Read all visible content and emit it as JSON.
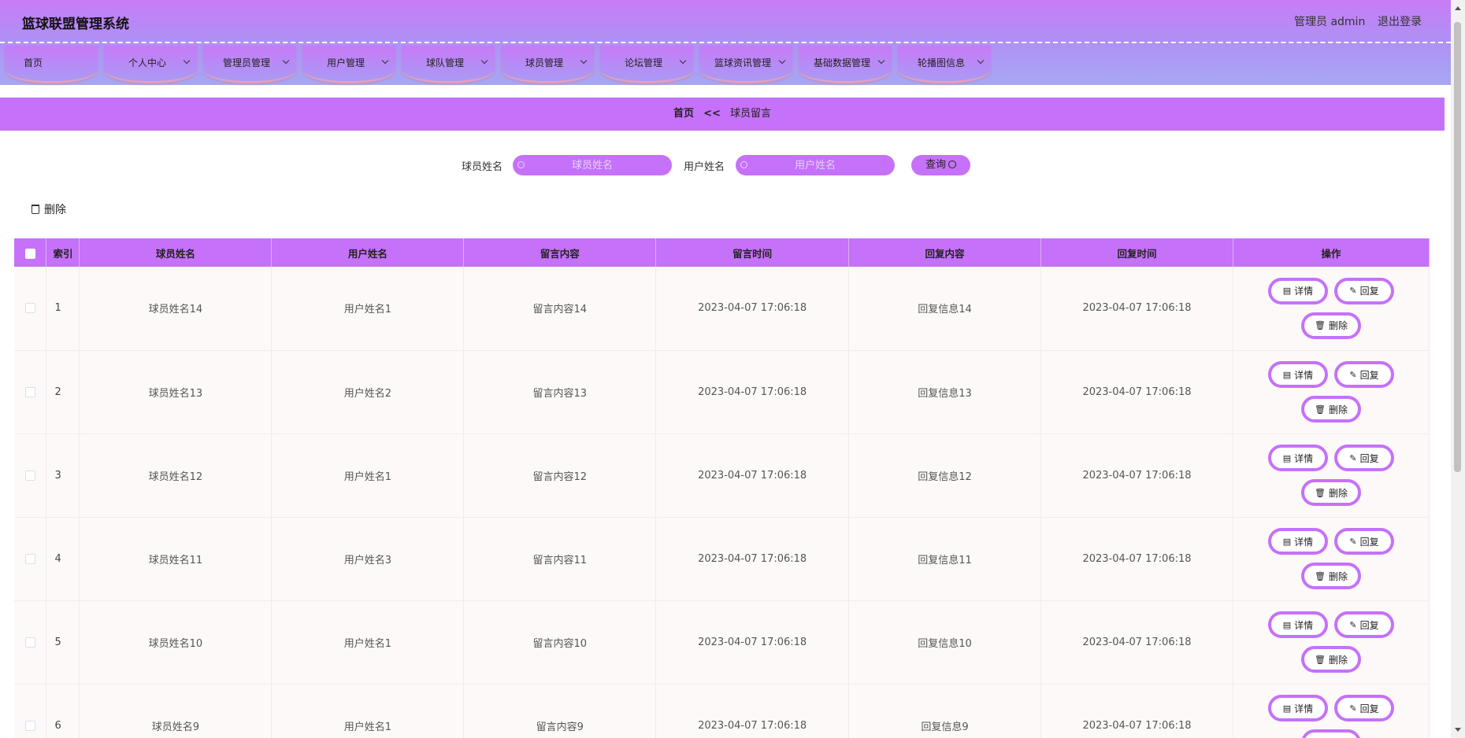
{
  "header": {
    "title": "篮球联盟管理系统",
    "user_label": "管理员 admin",
    "logout_label": "退出登录"
  },
  "nav": [
    {
      "label": "首页",
      "has_dropdown": false
    },
    {
      "label": "个人中心",
      "has_dropdown": true
    },
    {
      "label": "管理员管理",
      "has_dropdown": true
    },
    {
      "label": "用户管理",
      "has_dropdown": true
    },
    {
      "label": "球队管理",
      "has_dropdown": true
    },
    {
      "label": "球员管理",
      "has_dropdown": true
    },
    {
      "label": "论坛管理",
      "has_dropdown": true
    },
    {
      "label": "篮球资讯管理",
      "has_dropdown": true
    },
    {
      "label": "基础数据管理",
      "has_dropdown": true
    },
    {
      "label": "轮播图信息",
      "has_dropdown": true
    }
  ],
  "breadcrumb": {
    "home": "首页",
    "separator": "<<",
    "current": "球员留言"
  },
  "search": {
    "player_label": "球员姓名",
    "player_placeholder": "球员姓名",
    "user_label": "用户姓名",
    "user_placeholder": "用户姓名",
    "query_label": "查询"
  },
  "toolbar": {
    "delete_label": "删除"
  },
  "table": {
    "columns": [
      "索引",
      "球员姓名",
      "用户姓名",
      "留言内容",
      "留言时间",
      "回复内容",
      "回复时间",
      "操作"
    ],
    "rows": [
      {
        "index": "1",
        "player": "球员姓名14",
        "user": "用户姓名1",
        "content": "留言内容14",
        "time": "2023-04-07 17:06:18",
        "reply": "回复信息14",
        "reply_time": "2023-04-07 17:06:18"
      },
      {
        "index": "2",
        "player": "球员姓名13",
        "user": "用户姓名2",
        "content": "留言内容13",
        "time": "2023-04-07 17:06:18",
        "reply": "回复信息13",
        "reply_time": "2023-04-07 17:06:18"
      },
      {
        "index": "3",
        "player": "球员姓名12",
        "user": "用户姓名1",
        "content": "留言内容12",
        "time": "2023-04-07 17:06:18",
        "reply": "回复信息12",
        "reply_time": "2023-04-07 17:06:18"
      },
      {
        "index": "4",
        "player": "球员姓名11",
        "user": "用户姓名3",
        "content": "留言内容11",
        "time": "2023-04-07 17:06:18",
        "reply": "回复信息11",
        "reply_time": "2023-04-07 17:06:18"
      },
      {
        "index": "5",
        "player": "球员姓名10",
        "user": "用户姓名1",
        "content": "留言内容10",
        "time": "2023-04-07 17:06:18",
        "reply": "回复信息10",
        "reply_time": "2023-04-07 17:06:18"
      },
      {
        "index": "6",
        "player": "球员姓名9",
        "user": "用户姓名1",
        "content": "留言内容9",
        "time": "2023-04-07 17:06:18",
        "reply": "回复信息9",
        "reply_time": "2023-04-07 17:06:18"
      }
    ],
    "actions": {
      "detail": "详情",
      "reply": "回复",
      "delete": "删除"
    }
  },
  "colors": {
    "accent": "#c671f9",
    "header_gradient_top": "#c87cf6",
    "header_gradient_bottom": "#a7a7f3"
  }
}
